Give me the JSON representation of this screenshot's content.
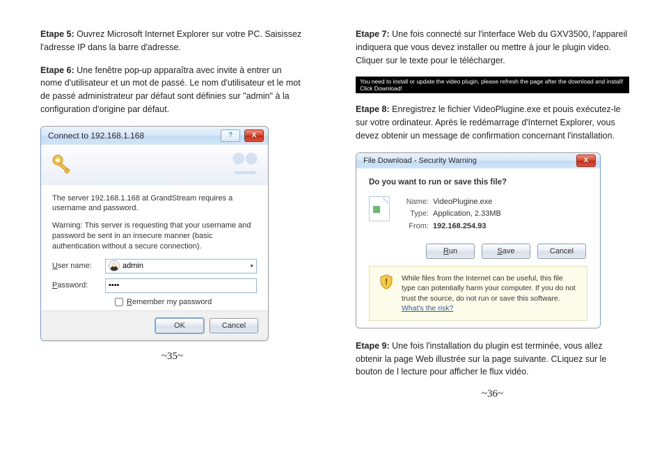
{
  "left": {
    "step5": {
      "label": "Etape 5:",
      "text": "Ouvrez Microsoft Internet Explorer sur votre PC. Saisissez l'adresse IP dans la barre d'adresse."
    },
    "step6": {
      "label": "Etape 6:",
      "text": "Une fenêtre pop-up apparaîtra avec invite à entrer un nome d'utilisateur et un mot de passé. Le nom d'utilisateur et le mot de passé administrateur par défaut sont définies sur \"admin\" à la configuration d'origine par défaut."
    },
    "pagenum": "~35~"
  },
  "right": {
    "step7": {
      "label": "Etape 7:",
      "text": "Une fois connecté sur l'interface Web du GXV3500, l'appareil indiquera que vous devez installer ou mettre à jour le plugin video. Cliquer sur le texte pour le télécharger."
    },
    "banner": "You need to install or update the video plugin, please refresh the page after the download and install! Click Download!",
    "step8": {
      "label": "Etape 8:",
      "text": "Enregistrez le fichier VideoPlugine.exe et pouis exécutez-le sur votre ordinateur. Après le redémarrage d'Internet Explorer, vous devez obtenir un message de confirmation concernant l'installation."
    },
    "step9": {
      "label": "Etape 9:",
      "text": "Une fois l'installation du plugin est terminée, vous allez obtenir la page Web illustrée sur la page suivante. CLiquez sur le bouton de l lecture pour afficher le flux vidéo."
    },
    "pagenum": "~36~"
  },
  "auth_dialog": {
    "title": "Connect to 192.168.1.168",
    "line1": "The server 192.168.1.168 at GrandStream requires a username and password.",
    "line2": "Warning: This server is requesting that your username and password be sent in an insecure manner (basic authentication without a secure connection).",
    "username_label": "User name:",
    "username_value": "admin",
    "password_label": "Password:",
    "password_value": "••••",
    "remember_label": "Remember my password",
    "remember_checked": false,
    "ok": "OK",
    "cancel": "Cancel",
    "help_glyph": "?",
    "close_glyph": "X"
  },
  "dl_dialog": {
    "title": "File Download - Security Warning",
    "question": "Do you want to run or save this file?",
    "name_k": "Name:",
    "name_v": "VideoPlugine.exe",
    "type_k": "Type:",
    "type_v": "Application, 2.33MB",
    "from_k": "From:",
    "from_v": "192.168.254.93",
    "run": "Run",
    "save": "Save",
    "cancel": "Cancel",
    "warn_text": "While files from the Internet can be useful, this file type can potentially harm your computer. If you do not trust the source, do not run or save this software. ",
    "risk_link": "What's the risk?",
    "close_glyph": "X"
  }
}
